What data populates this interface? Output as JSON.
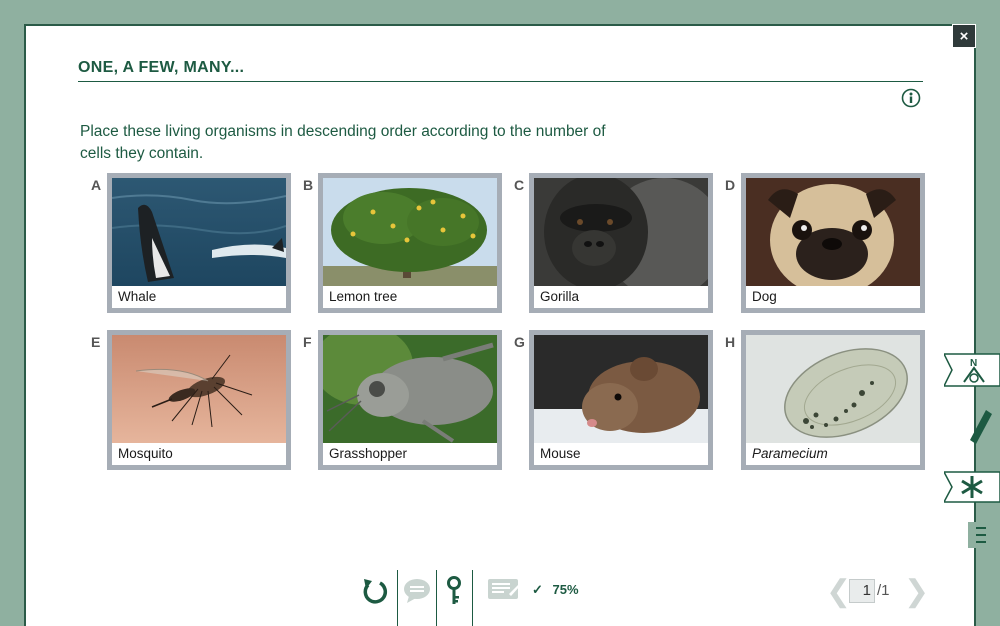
{
  "window": {
    "title": "ONE, A FEW, MANY...",
    "close_label": "×"
  },
  "instruction": "Place these living organisms in descending order according to the number of cells they contain.",
  "cards": [
    {
      "letter": "A",
      "label": "Whale"
    },
    {
      "letter": "B",
      "label": "Lemon tree"
    },
    {
      "letter": "C",
      "label": "Gorilla"
    },
    {
      "letter": "D",
      "label": "Dog"
    },
    {
      "letter": "E",
      "label": "Mosquito"
    },
    {
      "letter": "F",
      "label": "Grasshopper"
    },
    {
      "letter": "G",
      "label": "Mouse"
    },
    {
      "letter": "H",
      "label": "Paramecium",
      "italic": true
    }
  ],
  "toolbar": {
    "score_check": "✓",
    "score_value": "75%",
    "icons": [
      "reset-icon",
      "comment-icon",
      "key-icon",
      "notes-icon"
    ]
  },
  "pager": {
    "prev": "❮",
    "current": "1",
    "total": "/1",
    "next": "❯"
  },
  "side_tabs": {
    "compass_label": "N"
  },
  "colors": {
    "background": "#8fb0a0",
    "accent": "#1d5a42",
    "card_frame": "#a6adb6"
  }
}
